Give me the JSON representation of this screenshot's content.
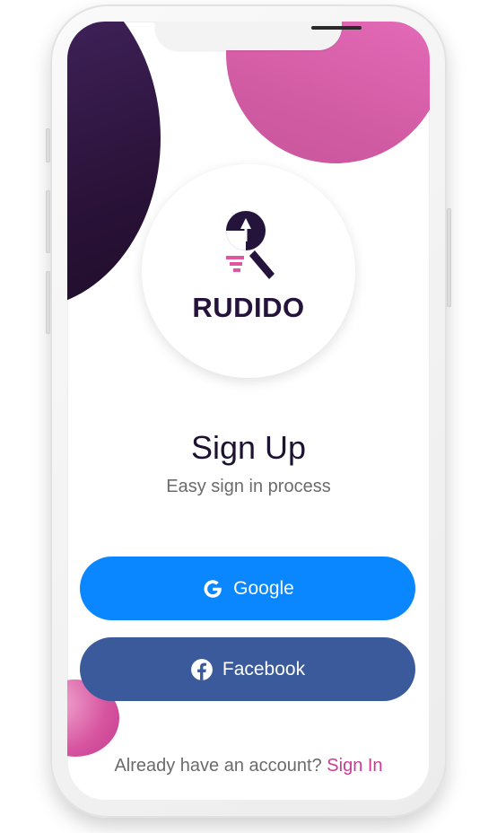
{
  "app": {
    "brand": "RUDIDO"
  },
  "screen": {
    "title": "Sign Up",
    "subtitle": "Easy sign in process"
  },
  "buttons": {
    "google_label": "Google",
    "facebook_label": "Facebook"
  },
  "footer": {
    "prompt": "Already have an account?",
    "link": "Sign In"
  },
  "icons": {
    "google": "google-icon",
    "facebook": "facebook-icon",
    "logo": "rudido-logo-icon"
  },
  "colors": {
    "google_button": "#0a86ff",
    "facebook_button": "#3a5a9c",
    "link": "#cc3c94",
    "brand_dark": "#24133a",
    "accent_pink": "#e0579f",
    "accent_purple": "#2a1238"
  }
}
